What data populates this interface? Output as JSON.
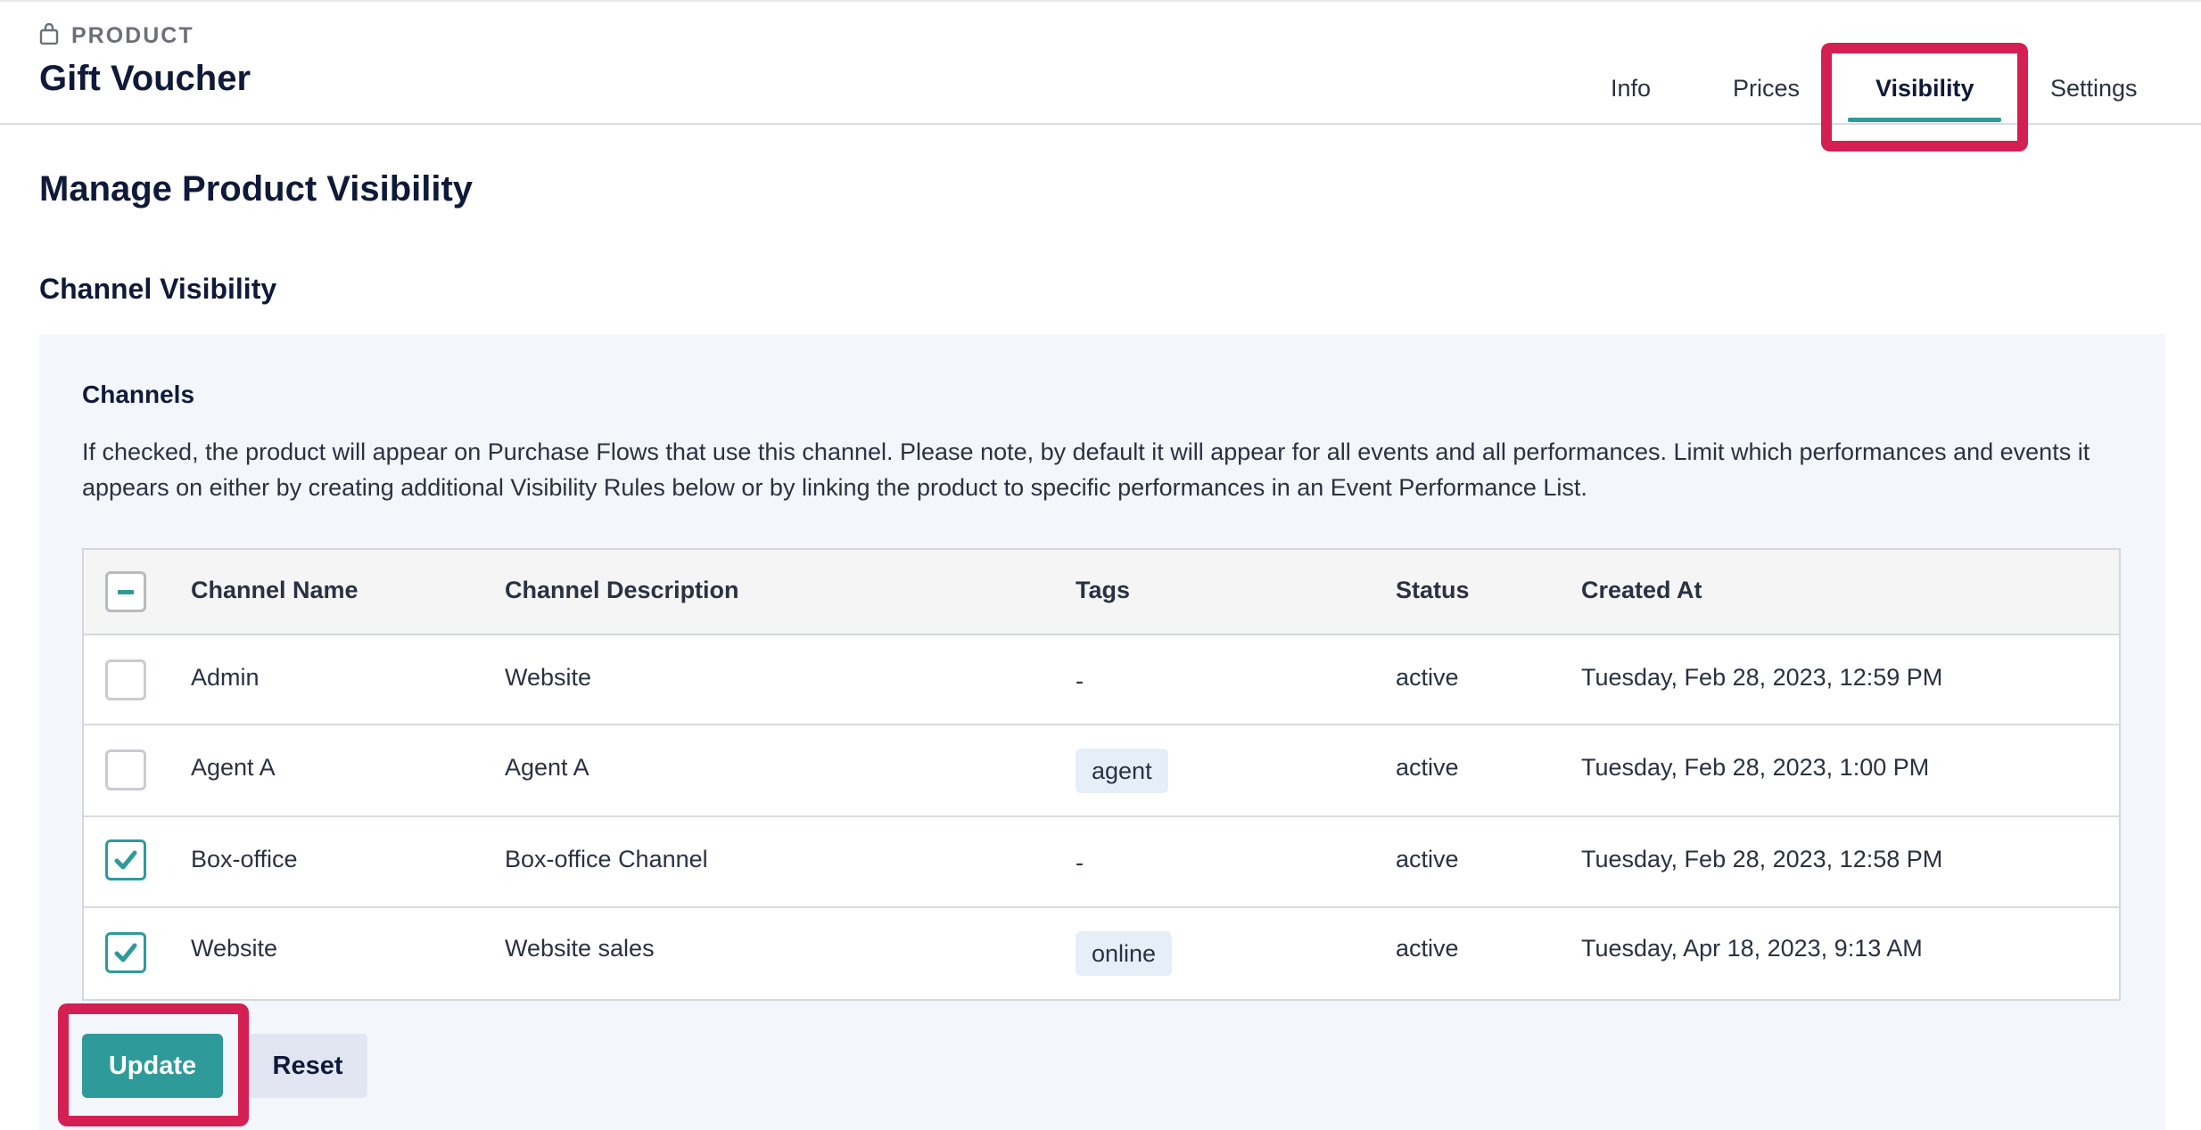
{
  "header": {
    "eyebrow": "PRODUCT",
    "eyebrow_icon": "shopping-bag-icon",
    "title": "Gift Voucher"
  },
  "tabs": [
    {
      "label": "Info",
      "active": false
    },
    {
      "label": "Prices",
      "active": false
    },
    {
      "label": "Visibility",
      "active": true
    },
    {
      "label": "Settings",
      "active": false
    }
  ],
  "page": {
    "title": "Manage Product Visibility",
    "section_title": "Channel Visibility"
  },
  "channels": {
    "title": "Channels",
    "description": "If checked, the product will appear on Purchase Flows that use this channel. Please note, by default it will appear for all events and all performances. Limit which performances and events it appears on either by creating additional Visibility Rules below or by linking the product to specific performances in an Event Performance List.",
    "columns": [
      "Channel Name",
      "Channel Description",
      "Tags",
      "Status",
      "Created At"
    ],
    "rows": [
      {
        "checked": false,
        "name": "Admin",
        "description": "Website",
        "tag": "",
        "tag_placeholder": "-",
        "status": "active",
        "created_at": "Tuesday, Feb 28, 2023, 12:59 PM"
      },
      {
        "checked": false,
        "name": "Agent A",
        "description": "Agent A",
        "tag": "agent",
        "tag_placeholder": "",
        "status": "active",
        "created_at": "Tuesday, Feb 28, 2023, 1:00 PM"
      },
      {
        "checked": true,
        "name": "Box-office",
        "description": "Box-office Channel",
        "tag": "",
        "tag_placeholder": "-",
        "status": "active",
        "created_at": "Tuesday, Feb 28, 2023, 12:58 PM"
      },
      {
        "checked": true,
        "name": "Website",
        "description": "Website sales",
        "tag": "online",
        "tag_placeholder": "",
        "status": "active",
        "created_at": "Tuesday, Apr 18, 2023, 9:13 AM"
      }
    ]
  },
  "actions": {
    "update_label": "Update",
    "reset_label": "Reset"
  },
  "colors": {
    "accent": "#2f9a9a",
    "highlight": "#d41f52",
    "panel_bg": "#f3f6fb",
    "tag_bg": "#e6eef8"
  }
}
